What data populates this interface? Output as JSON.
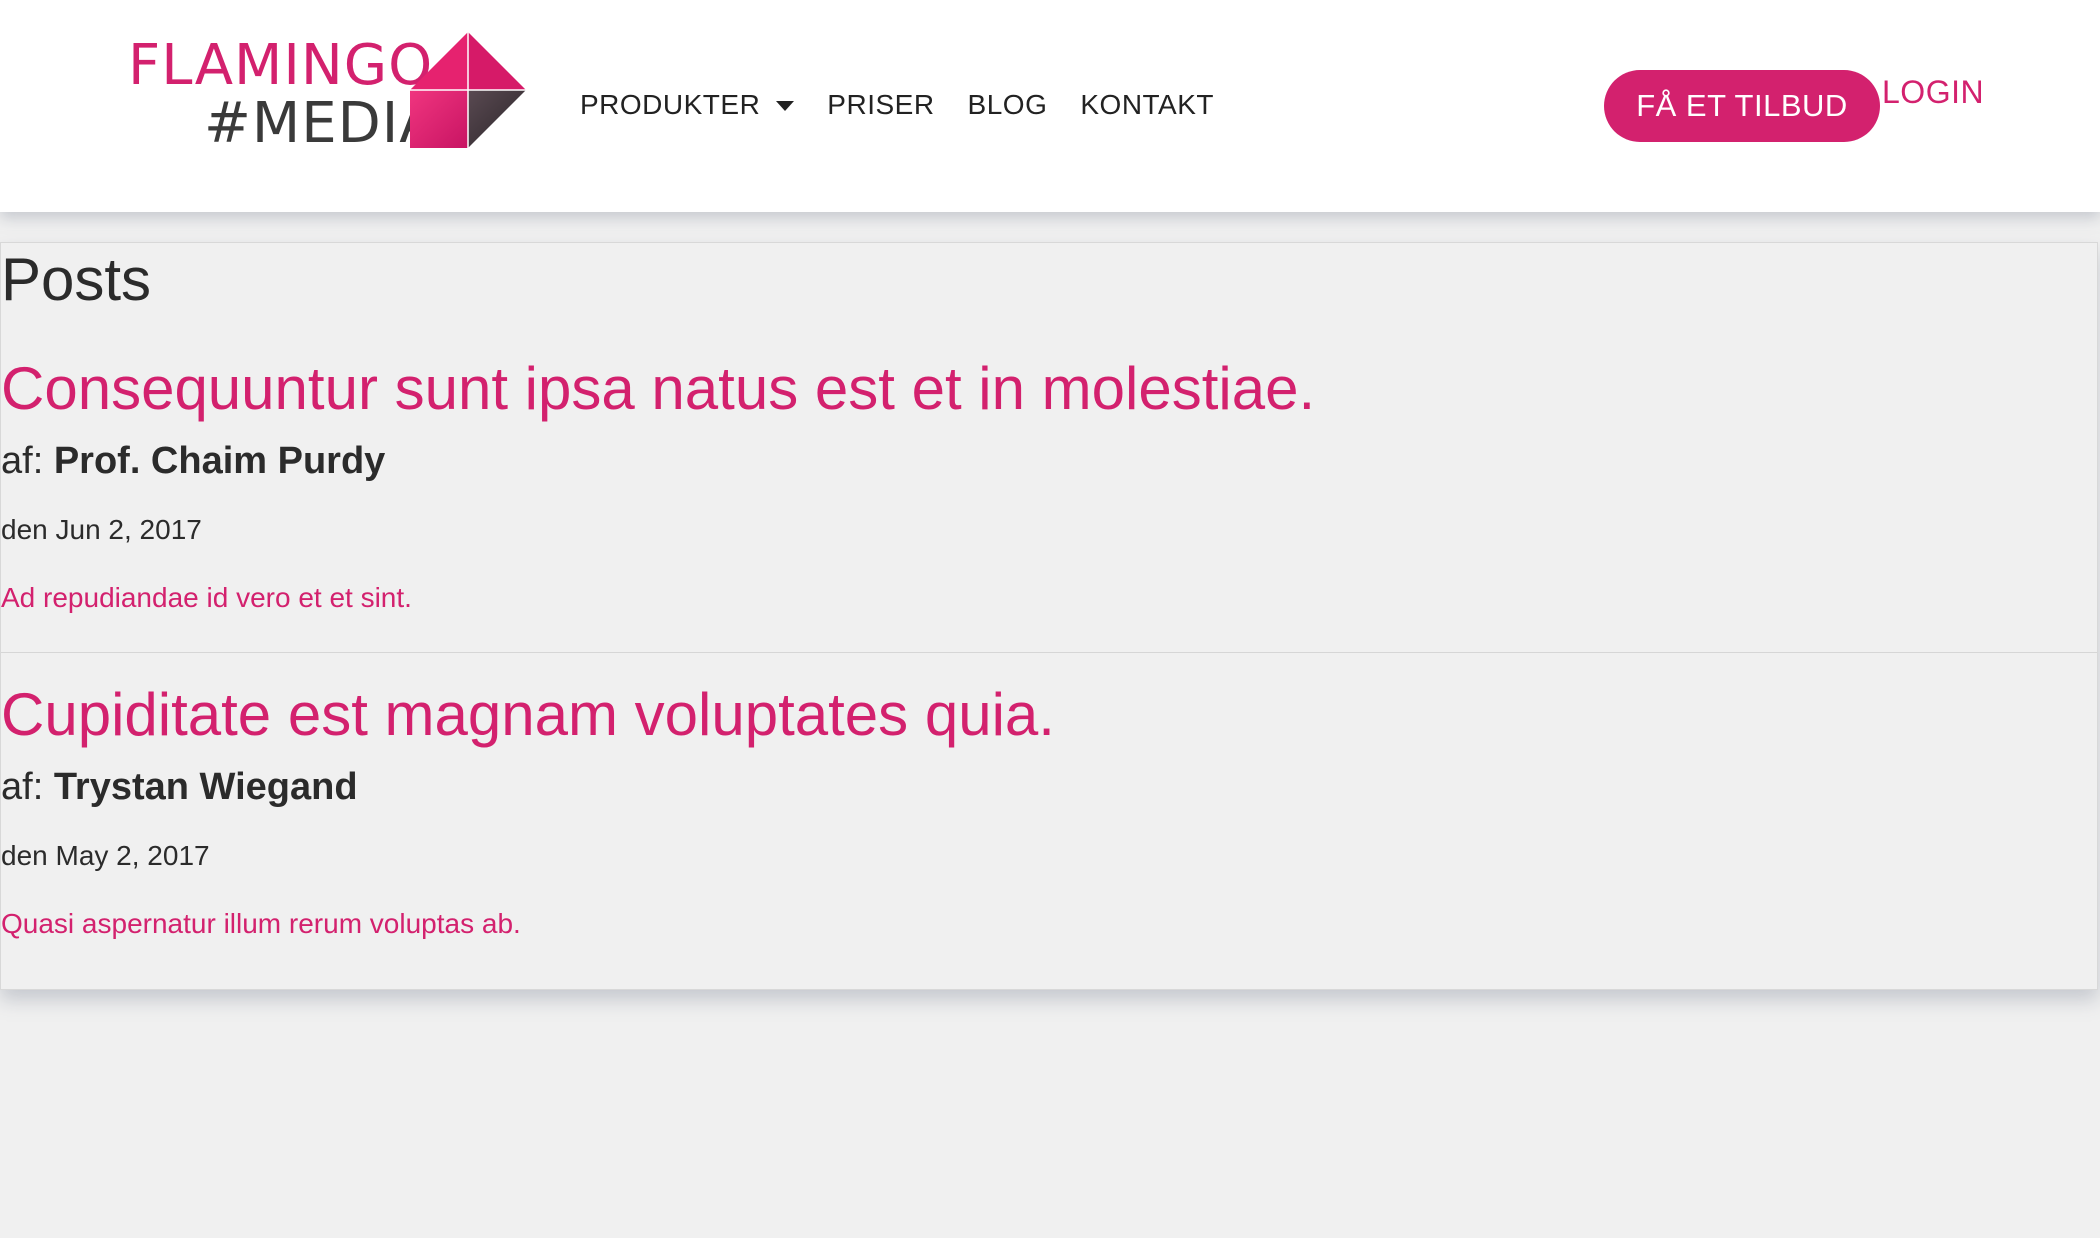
{
  "brand": {
    "line1": "FLAMINGO",
    "line2": "#MEDIA",
    "accent_color": "#d3216e",
    "dark_color": "#3a3a3a"
  },
  "nav": {
    "items": [
      {
        "label": "PRODUKTER",
        "icon": "chevron-down-icon"
      },
      {
        "label": "PRISER"
      },
      {
        "label": "BLOG"
      },
      {
        "label": "KONTAKT"
      }
    ]
  },
  "header": {
    "cta_label": "FÅ ET TILBUD",
    "login_label": "LOGIN"
  },
  "main": {
    "heading": "Posts",
    "author_prefix": "af:",
    "posts": [
      {
        "title": "Consequuntur sunt ipsa natus est et in molestiae.",
        "author": "Prof. Chaim Purdy",
        "date": "den Jun 2, 2017",
        "excerpt": "Ad repudiandae id vero et et sint."
      },
      {
        "title": "Cupiditate est magnam voluptates quia.",
        "author": "Trystan Wiegand",
        "date": "den May 2, 2017",
        "excerpt": "Quasi aspernatur illum rerum voluptas ab."
      }
    ]
  }
}
